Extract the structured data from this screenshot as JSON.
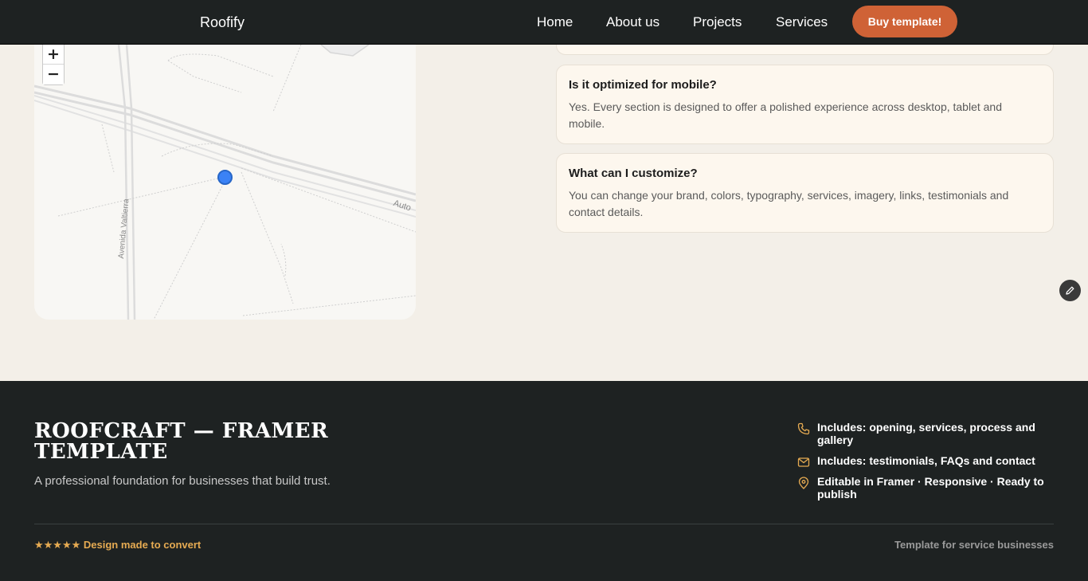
{
  "nav": {
    "brand": "Roofify",
    "links": [
      "Home",
      "About us",
      "Projects",
      "Services"
    ],
    "cta": "Buy template!"
  },
  "map": {
    "zoom_in": "+",
    "zoom_out": "−",
    "street_1": "Avenida Valtierra",
    "street_2": "Auto"
  },
  "faq": [
    {
      "question": "Is it optimized for mobile?",
      "answer": "Yes. Every section is designed to offer a polished experience across desktop, tablet and mobile."
    },
    {
      "question": "What can I customize?",
      "answer": "You can change your brand, colors, typography, services, imagery, links, testimonials and contact details."
    }
  ],
  "footer": {
    "title": "ROOFCRAFT — FRAMER TEMPLATE",
    "tagline": "A professional foundation for businesses that build trust.",
    "items": [
      {
        "icon": "phone-icon",
        "text": "Includes: opening, services, process and gallery"
      },
      {
        "icon": "mail-icon",
        "text": "Includes: testimonials, FAQs and contact"
      },
      {
        "icon": "location-pin-icon",
        "text": "Editable in Framer · Responsive · Ready to publish"
      }
    ],
    "rating": "★★★★★ Design made to convert",
    "right_text": "Template for service businesses"
  },
  "colors": {
    "accent": "#cf6236",
    "dark": "#1e2222",
    "background": "#f3efe8",
    "card": "#fdf7ee",
    "gold": "#e6ab52"
  }
}
